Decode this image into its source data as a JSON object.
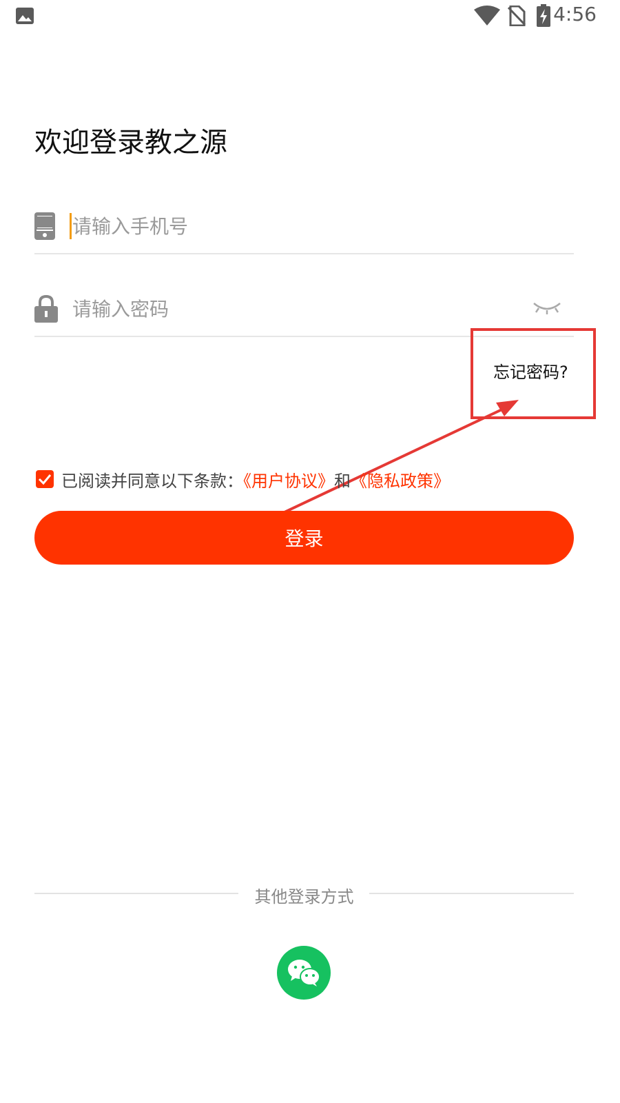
{
  "status_bar": {
    "time": "4:56"
  },
  "title": "欢迎登录教之源",
  "phone": {
    "placeholder": "请输入手机号"
  },
  "password": {
    "placeholder": "请输入密码"
  },
  "forgot_password": "忘记密码?",
  "agreement": {
    "text": "已阅读并同意以下条款：",
    "user_agreement": "《用户协议》",
    "and": "和",
    "privacy_policy": "《隐私政策》",
    "checked": true
  },
  "login_button": "登录",
  "other_login": {
    "label": "其他登录方式"
  },
  "colors": {
    "accent": "#ff3300",
    "wechat": "#16c160",
    "annotation": "#e53935"
  }
}
